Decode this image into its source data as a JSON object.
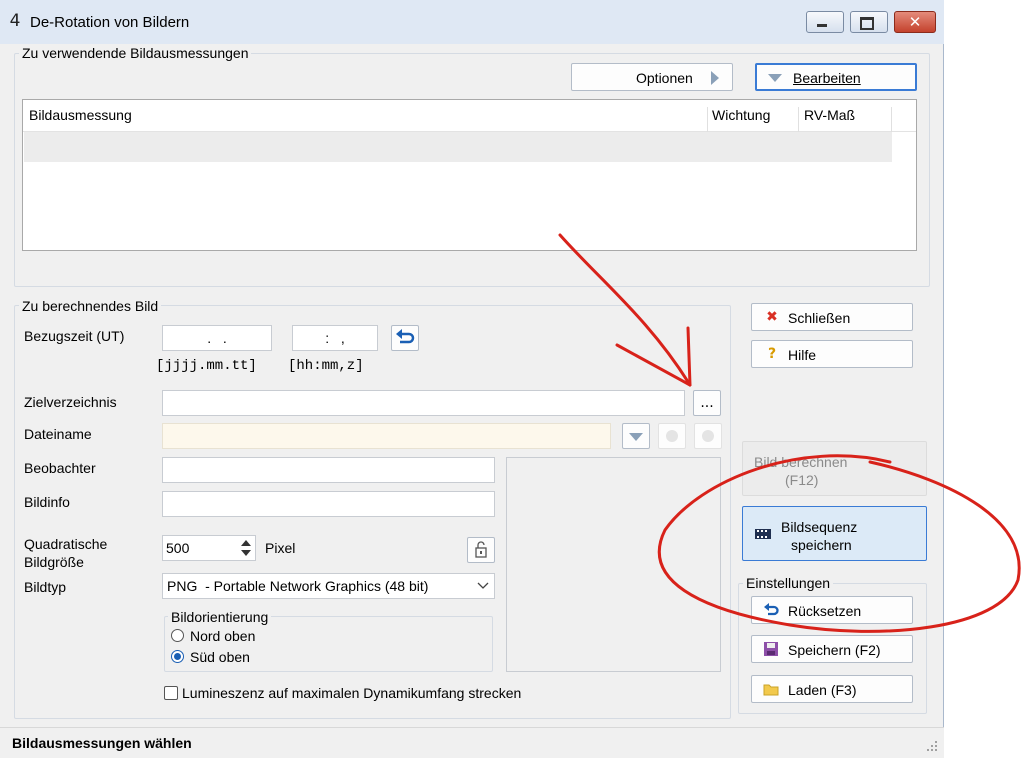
{
  "window": {
    "title": "De-Rotation von Bildern",
    "app_icon": "4",
    "close_glyph": "✕"
  },
  "measurements_group": {
    "label": "Zu verwendende Bildausmessungen",
    "options_label": "Optionen",
    "edit_label": "Bearbeiten",
    "columns": [
      "Bildausmessung",
      "Wichtung",
      "RV-Maß"
    ]
  },
  "image_group": {
    "label": "Zu berechnendes Bild",
    "ref_time_label": "Bezugszeit (UT)",
    "date_value": ".   .",
    "time_value": ":   ,",
    "date_format": "[jjjj.mm.tt]",
    "time_format": "[hh:mm,z]",
    "target_dir_label": "Zielverzeichnis",
    "browse_label": "...",
    "filename_label": "Dateiname",
    "observer_label": "Beobachter",
    "imageinfo_label": "Bildinfo",
    "square_size_label_1": "Quadratische",
    "square_size_label_2": "Bildgröße",
    "square_size_value": "500",
    "pixel_label": "Pixel",
    "imagetype_label": "Bildtyp",
    "imagetype_value": "PNG  - Portable Network Graphics (48 bit)",
    "orientation_label": "Bildorientierung",
    "orient_north": "Nord oben",
    "orient_south": "Süd oben",
    "orientation_selected": "Süd oben",
    "luminance_label": "Lumineszenz auf maximalen Dynamikumfang strecken"
  },
  "right_panel": {
    "close_label": "Schließen",
    "help_label": "Hilfe",
    "compute_label_1": "Bild berechnen",
    "compute_label_2": "(F12)",
    "sequence_label_1": "Bildsequenz",
    "sequence_label_2": "speichern",
    "settings_label": "Einstellungen",
    "reset_label": "Rücksetzen",
    "save_label": "Speichern (F2)",
    "load_label": "Laden (F3)"
  },
  "status": {
    "text": "Bildausmessungen wählen"
  },
  "colors": {
    "annotation_red": "#d8221a",
    "sequence_button_bg": "#dceaf7",
    "filename_bg": "#fdf8ec"
  }
}
